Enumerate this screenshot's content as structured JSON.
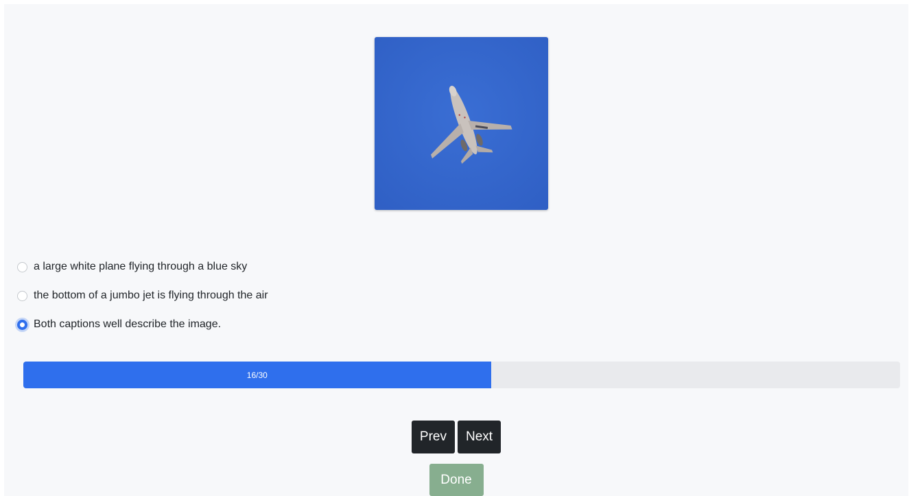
{
  "question": {
    "image_icon": "airplane-in-blue-sky-image",
    "options": [
      {
        "label": "a large white plane flying through a blue sky",
        "checked": false
      },
      {
        "label": "the bottom of a jumbo jet is flying through the air",
        "checked": false
      },
      {
        "label": "Both captions well describe the image.",
        "checked": true
      }
    ]
  },
  "progress": {
    "text": "16/30",
    "current": 16,
    "total": 30
  },
  "nav": {
    "prev_label": "Prev",
    "next_label": "Next",
    "done_label": "Done"
  },
  "colors": {
    "accent": "#2f6fed",
    "dark_button": "#212529",
    "done_button": "#87ae8f",
    "sky": "#3566cc"
  }
}
